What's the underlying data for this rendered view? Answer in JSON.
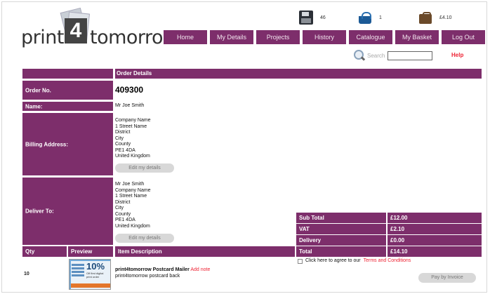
{
  "brand": {
    "word1": "print",
    "digit": "4",
    "word2": "tomorrow"
  },
  "stats": {
    "saved": "46",
    "basket": "1",
    "balance": "£4.10"
  },
  "nav": [
    "Home",
    "My Details",
    "Projects",
    "History",
    "Catalogue",
    "My Basket",
    "Log Out"
  ],
  "search": {
    "label": "Search",
    "value": ""
  },
  "help": "Help",
  "order": {
    "section_title": "Order Details",
    "order_no_label": "Order No.",
    "order_no": "409300",
    "name_label": "Name:",
    "name": "Mr Joe Smith",
    "billing_label": "Billing Address:",
    "billing": [
      "Company Name",
      "1 Street Name",
      "District",
      "City",
      "County",
      "PE1 4DA",
      "United Kingdom"
    ],
    "edit_label": "Edit my details",
    "deliver_label": "Deliver To:",
    "deliver": [
      "Mr Joe Smith",
      "Company Name",
      "1 Street Name",
      "District",
      "City",
      "County",
      "PE1 4DA",
      "United Kingdom"
    ]
  },
  "totals": [
    {
      "label": "Sub Total",
      "value": "£12.00"
    },
    {
      "label": "VAT",
      "value": "£2.10"
    },
    {
      "label": "Delivery",
      "value": "£0.00"
    },
    {
      "label": "Total",
      "value": "£14.10"
    }
  ],
  "items_header": {
    "qty": "Qty",
    "preview": "Preview",
    "desc": "Item Description"
  },
  "item": {
    "qty": "10",
    "title": "print4tomorrow Postcard Mailer",
    "add_note": "Add note",
    "subtitle": "print4tomorrow postcard back",
    "preview_pct": "10%",
    "preview_sub": "Off first digital print order"
  },
  "terms": {
    "text": "Click here to agree to our",
    "link": "Terms and Conditions"
  },
  "pay_button": "Pay by Invoice"
}
